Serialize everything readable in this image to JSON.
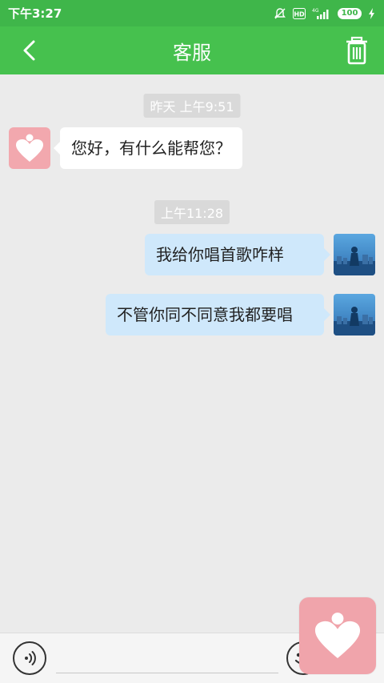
{
  "status_bar": {
    "time": "下午3:27",
    "network": "4G",
    "battery": "100"
  },
  "header": {
    "title": "客服"
  },
  "messages": [
    {
      "type": "timestamp",
      "text": "昨天 上午9:51"
    },
    {
      "type": "incoming",
      "text": "您好，有什么能帮您？"
    },
    {
      "type": "timestamp",
      "text": "上午11:28"
    },
    {
      "type": "outgoing",
      "text": "我给你唱首歌咋样"
    },
    {
      "type": "outgoing",
      "text": "不管你同不同意我都要唱"
    }
  ],
  "input": {
    "placeholder": "",
    "value": ""
  },
  "icons": {
    "back": "chevron-left-icon",
    "delete": "trash-icon",
    "voice": "voice-icon",
    "emoji": "emoji-icon",
    "brand": "heart-logo-icon"
  },
  "colors": {
    "header_green": "#46c14e",
    "status_green": "#3fb64a",
    "outgoing_bubble": "#cfe8fb",
    "incoming_bubble": "#ffffff",
    "brand_pink": "#f2a8ae"
  }
}
